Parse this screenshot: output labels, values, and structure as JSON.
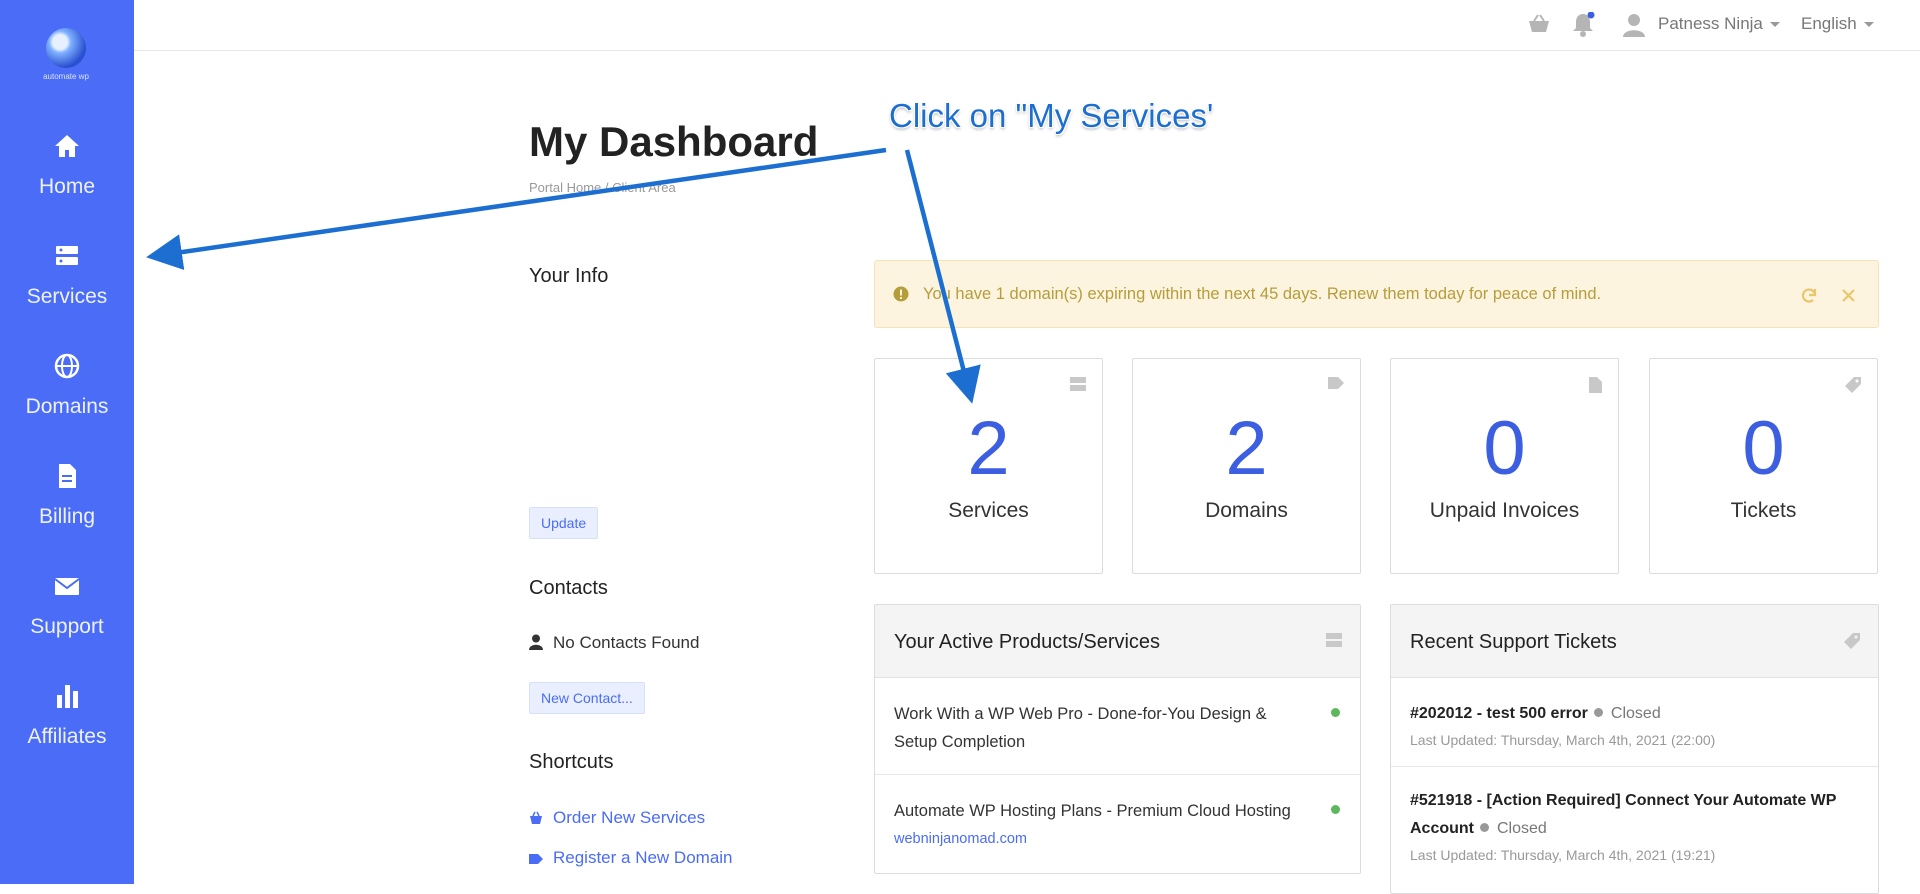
{
  "sidebar": {
    "logo_text": "automate wp",
    "items": [
      {
        "label": "Home",
        "icon": "home-icon"
      },
      {
        "label": "Services",
        "icon": "server-icon"
      },
      {
        "label": "Domains",
        "icon": "globe-icon"
      },
      {
        "label": "Billing",
        "icon": "file-icon"
      },
      {
        "label": "Support",
        "icon": "envelope-icon"
      },
      {
        "label": "Affiliates",
        "icon": "bar-chart-icon"
      }
    ]
  },
  "topbar": {
    "user_name": "Patness Ninja",
    "language": "English"
  },
  "page": {
    "title": "My Dashboard",
    "breadcrumb": "Portal Home / Client Area"
  },
  "your_info": {
    "heading": "Your Info",
    "update_button": "Update"
  },
  "contacts": {
    "heading": "Contacts",
    "empty_text": "No Contacts Found",
    "new_button": "New Contact..."
  },
  "shortcuts": {
    "heading": "Shortcuts",
    "items": [
      {
        "label": "Order New Services",
        "icon": "basket-icon"
      },
      {
        "label": "Register a New Domain",
        "icon": "tag-icon"
      }
    ]
  },
  "alert": {
    "message": "You have 1 domain(s) expiring within the next 45 days. Renew them today for peace of mind."
  },
  "stats": [
    {
      "value": "2",
      "label": "Services",
      "icon": "server-icon"
    },
    {
      "value": "2",
      "label": "Domains",
      "icon": "tag-icon"
    },
    {
      "value": "0",
      "label": "Unpaid Invoices",
      "icon": "file-icon"
    },
    {
      "value": "0",
      "label": "Tickets",
      "icon": "ticket-icon"
    }
  ],
  "products_panel": {
    "title": "Your Active Products/Services",
    "items": [
      {
        "name": "Work With a WP Web Pro - Done-for-You Design & Setup Completion",
        "domain": "",
        "status_color": "#5cb85c"
      },
      {
        "name": "Automate WP Hosting Plans - Premium Cloud Hosting",
        "domain": "webninjanomad.com",
        "status_color": "#5cb85c"
      }
    ]
  },
  "tickets_panel": {
    "title": "Recent Support Tickets",
    "items": [
      {
        "title": "#202012 - test 500 error",
        "status": "Closed",
        "updated": "Last Updated: Thursday, March 4th, 2021 (22:00)"
      },
      {
        "title": "#521918 - [Action Required] Connect Your Automate WP Account",
        "status": "Closed",
        "updated": "Last Updated: Thursday, March 4th, 2021 (19:21)"
      }
    ]
  },
  "annotation": {
    "text": "Click on \"My Services'"
  },
  "colors": {
    "sidebar": "#4a6cf7",
    "accent": "#3b5fe0",
    "alert_bg": "#fdf4e0",
    "alert_text": "#b59d3a",
    "annotation_arrow": "#1c6fd1",
    "active_status": "#5cb85c"
  }
}
